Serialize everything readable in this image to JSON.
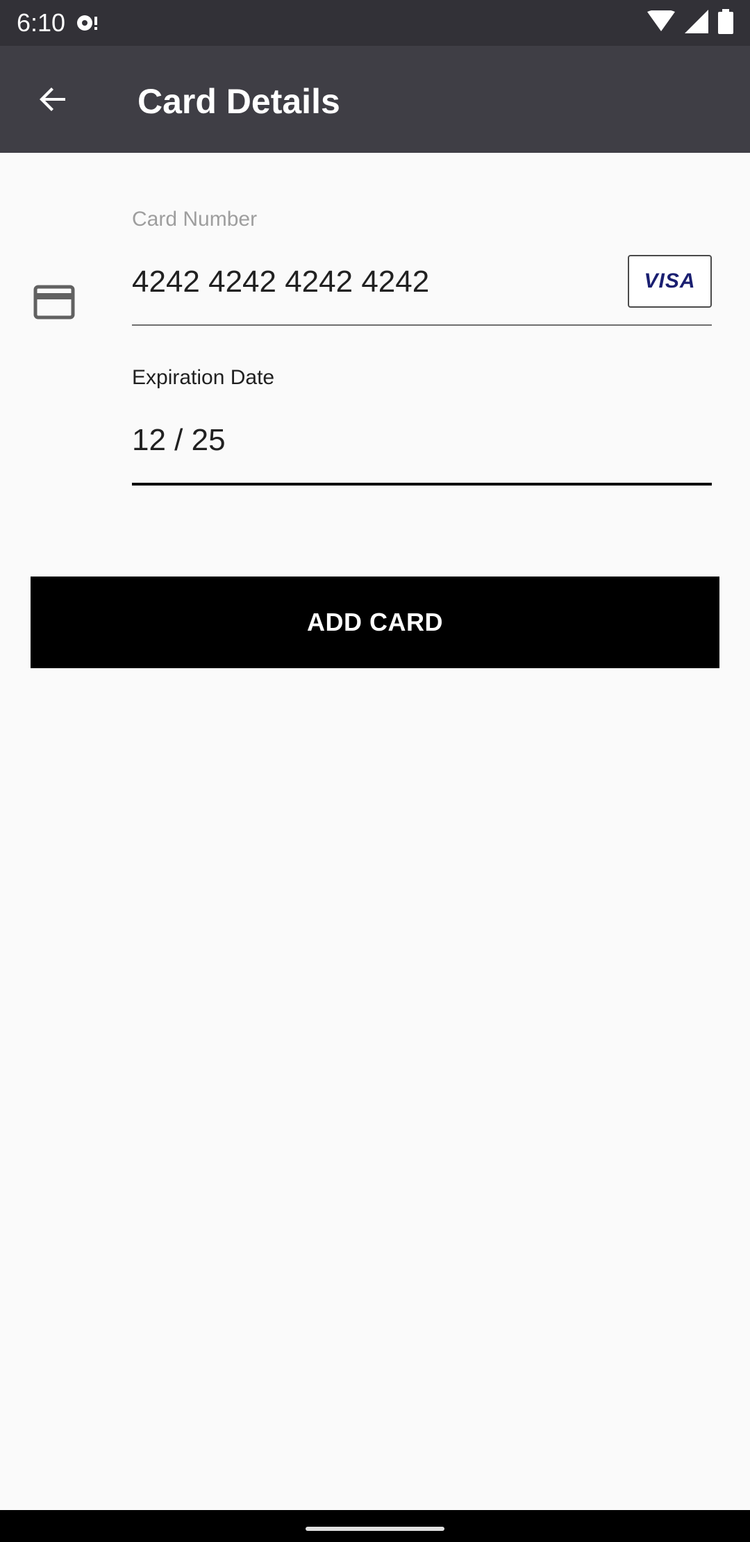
{
  "status_bar": {
    "time": "6:10",
    "icons": [
      "notification-icon",
      "wifi-icon",
      "signal-icon",
      "battery-icon"
    ]
  },
  "toolbar": {
    "back_icon": "arrow-back-icon",
    "title": "Card Details"
  },
  "form": {
    "card_number": {
      "label": "Card Number",
      "value": "4242 4242 4242 4242",
      "brand": "VISA"
    },
    "expiration": {
      "label": "Expiration Date",
      "value": "12 / 25"
    }
  },
  "actions": {
    "add_card_label": "ADD CARD"
  },
  "colors": {
    "status_bar": "#323137",
    "toolbar": "#3f3e45",
    "background": "#fafafa",
    "button": "#000000",
    "visa_blue": "#1a1f71"
  }
}
